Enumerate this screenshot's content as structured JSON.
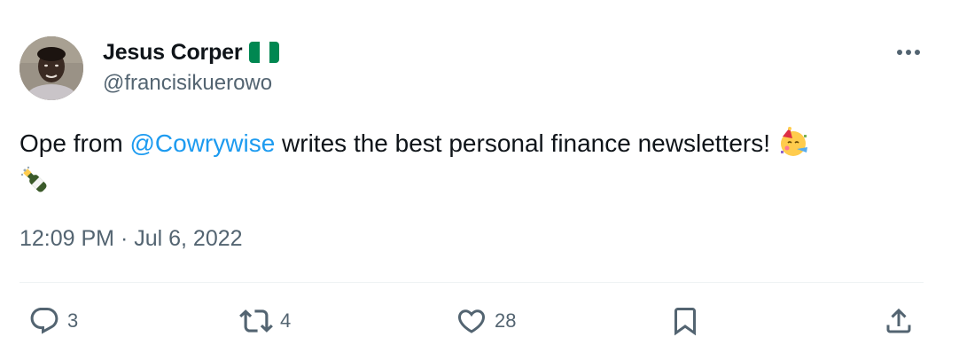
{
  "author": {
    "display_name": "Jesus Corper",
    "handle": "@francisikuerowo",
    "flag_icon": "nigeria-flag-icon",
    "flag_colors": [
      "#008751",
      "#ffffff",
      "#008751"
    ]
  },
  "tweet": {
    "text_before": "Ope from ",
    "mention": "@Cowrywise",
    "text_after": " writes the best personal finance newsletters!",
    "emojis": [
      "partying-face-icon",
      "champagne-bottle-icon"
    ],
    "timestamp": "12:09 PM · Jul 6, 2022"
  },
  "actions": {
    "reply": {
      "icon": "reply-icon",
      "count": "3"
    },
    "retweet": {
      "icon": "retweet-icon",
      "count": "4"
    },
    "like": {
      "icon": "heart-icon",
      "count": "28"
    },
    "bookmark": {
      "icon": "bookmark-icon"
    },
    "share": {
      "icon": "share-icon"
    }
  },
  "colors": {
    "text": "#0f1419",
    "secondary": "#536471",
    "link": "#1d9bf0",
    "divider": "#eff3f4"
  }
}
